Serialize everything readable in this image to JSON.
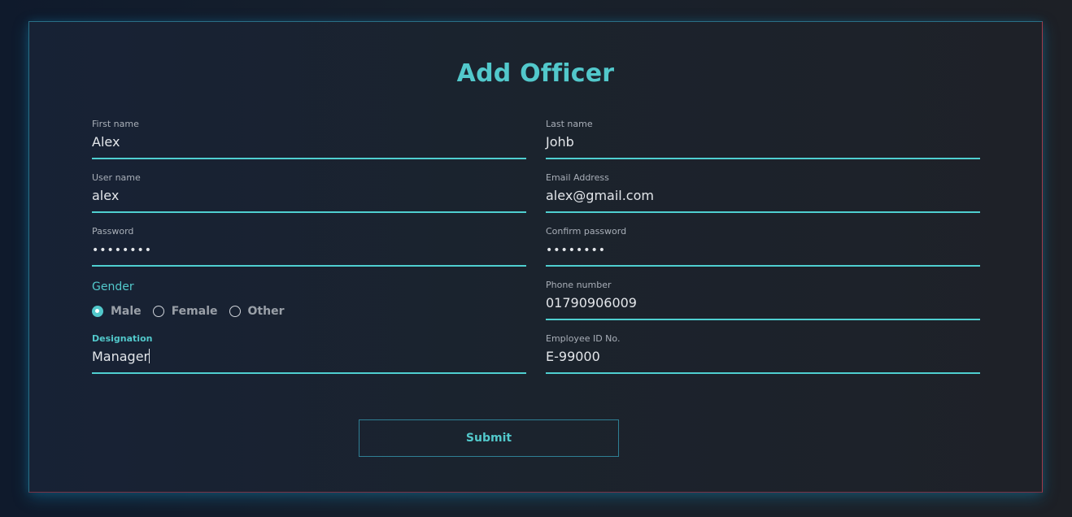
{
  "form": {
    "title": "Add Officer",
    "fields": {
      "first_name": {
        "label": "First name",
        "value": "Alex"
      },
      "last_name": {
        "label": "Last name",
        "value": "Johb"
      },
      "user_name": {
        "label": "User name",
        "value": "alex"
      },
      "email": {
        "label": "Email Address",
        "value": "alex@gmail.com"
      },
      "password": {
        "label": "Password",
        "value": "••••••••"
      },
      "confirm_password": {
        "label": "Confirm password",
        "value": "••••••••"
      },
      "phone": {
        "label": "Phone number",
        "value": "01790906009"
      },
      "designation": {
        "label": "Designation",
        "value": "Manager"
      },
      "employee_id": {
        "label": "Employee ID No.",
        "value": "E-99000"
      }
    },
    "gender": {
      "label": "Gender",
      "options": [
        "Male",
        "Female",
        "Other"
      ],
      "selected": "Male"
    },
    "submit_label": "Submit"
  },
  "colors": {
    "accent": "#52c8cb",
    "background": "#1b232d",
    "text": "#e3e6ea"
  }
}
